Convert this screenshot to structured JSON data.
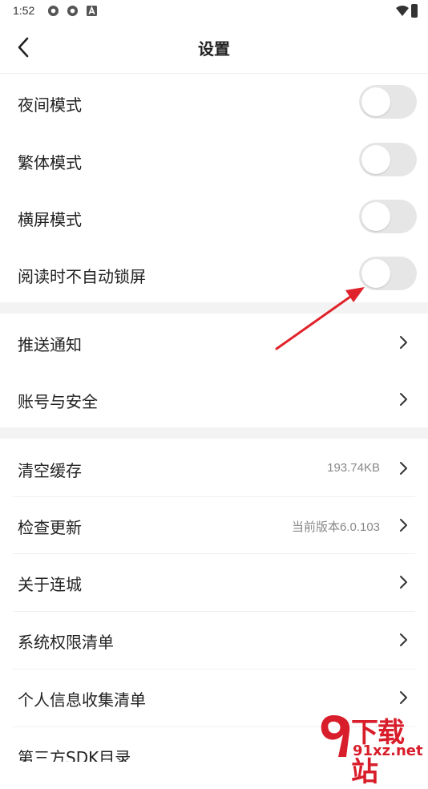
{
  "status_bar": {
    "time": "1:52"
  },
  "header": {
    "title": "设置"
  },
  "toggles": [
    {
      "label": "夜间模式",
      "on": false
    },
    {
      "label": "繁体模式",
      "on": false
    },
    {
      "label": "横屏模式",
      "on": false
    },
    {
      "label": "阅读时不自动锁屏",
      "on": false
    }
  ],
  "nav_group1": [
    {
      "label": "推送通知"
    },
    {
      "label": "账号与安全"
    }
  ],
  "nav_group2": [
    {
      "label": "清空缓存",
      "value": "193.74KB"
    },
    {
      "label": "检查更新",
      "value": "当前版本6.0.103"
    },
    {
      "label": "关于连城"
    },
    {
      "label": "系统权限清单"
    },
    {
      "label": "个人信息收集清单"
    },
    {
      "label": "第三方SDK目录"
    }
  ],
  "watermark": {
    "brand": "下载站",
    "url": "91xz.net"
  },
  "colors": {
    "toggle_off": "#e6e6e6",
    "annotation_arrow": "#e0232b",
    "watermark": "#d81e2b"
  }
}
